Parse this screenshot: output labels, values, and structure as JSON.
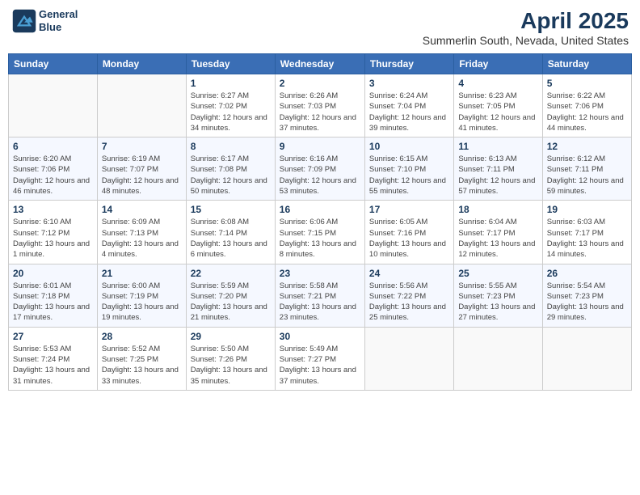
{
  "logo": {
    "line1": "General",
    "line2": "Blue"
  },
  "title": "April 2025",
  "subtitle": "Summerlin South, Nevada, United States",
  "weekdays": [
    "Sunday",
    "Monday",
    "Tuesday",
    "Wednesday",
    "Thursday",
    "Friday",
    "Saturday"
  ],
  "weeks": [
    [
      {
        "day": "",
        "empty": true
      },
      {
        "day": "",
        "empty": true
      },
      {
        "day": "1",
        "sunrise": "6:27 AM",
        "sunset": "7:02 PM",
        "daylight": "12 hours and 34 minutes."
      },
      {
        "day": "2",
        "sunrise": "6:26 AM",
        "sunset": "7:03 PM",
        "daylight": "12 hours and 37 minutes."
      },
      {
        "day": "3",
        "sunrise": "6:24 AM",
        "sunset": "7:04 PM",
        "daylight": "12 hours and 39 minutes."
      },
      {
        "day": "4",
        "sunrise": "6:23 AM",
        "sunset": "7:05 PM",
        "daylight": "12 hours and 41 minutes."
      },
      {
        "day": "5",
        "sunrise": "6:22 AM",
        "sunset": "7:06 PM",
        "daylight": "12 hours and 44 minutes."
      }
    ],
    [
      {
        "day": "6",
        "sunrise": "6:20 AM",
        "sunset": "7:06 PM",
        "daylight": "12 hours and 46 minutes."
      },
      {
        "day": "7",
        "sunrise": "6:19 AM",
        "sunset": "7:07 PM",
        "daylight": "12 hours and 48 minutes."
      },
      {
        "day": "8",
        "sunrise": "6:17 AM",
        "sunset": "7:08 PM",
        "daylight": "12 hours and 50 minutes."
      },
      {
        "day": "9",
        "sunrise": "6:16 AM",
        "sunset": "7:09 PM",
        "daylight": "12 hours and 53 minutes."
      },
      {
        "day": "10",
        "sunrise": "6:15 AM",
        "sunset": "7:10 PM",
        "daylight": "12 hours and 55 minutes."
      },
      {
        "day": "11",
        "sunrise": "6:13 AM",
        "sunset": "7:11 PM",
        "daylight": "12 hours and 57 minutes."
      },
      {
        "day": "12",
        "sunrise": "6:12 AM",
        "sunset": "7:11 PM",
        "daylight": "12 hours and 59 minutes."
      }
    ],
    [
      {
        "day": "13",
        "sunrise": "6:10 AM",
        "sunset": "7:12 PM",
        "daylight": "13 hours and 1 minute."
      },
      {
        "day": "14",
        "sunrise": "6:09 AM",
        "sunset": "7:13 PM",
        "daylight": "13 hours and 4 minutes."
      },
      {
        "day": "15",
        "sunrise": "6:08 AM",
        "sunset": "7:14 PM",
        "daylight": "13 hours and 6 minutes."
      },
      {
        "day": "16",
        "sunrise": "6:06 AM",
        "sunset": "7:15 PM",
        "daylight": "13 hours and 8 minutes."
      },
      {
        "day": "17",
        "sunrise": "6:05 AM",
        "sunset": "7:16 PM",
        "daylight": "13 hours and 10 minutes."
      },
      {
        "day": "18",
        "sunrise": "6:04 AM",
        "sunset": "7:17 PM",
        "daylight": "13 hours and 12 minutes."
      },
      {
        "day": "19",
        "sunrise": "6:03 AM",
        "sunset": "7:17 PM",
        "daylight": "13 hours and 14 minutes."
      }
    ],
    [
      {
        "day": "20",
        "sunrise": "6:01 AM",
        "sunset": "7:18 PM",
        "daylight": "13 hours and 17 minutes."
      },
      {
        "day": "21",
        "sunrise": "6:00 AM",
        "sunset": "7:19 PM",
        "daylight": "13 hours and 19 minutes."
      },
      {
        "day": "22",
        "sunrise": "5:59 AM",
        "sunset": "7:20 PM",
        "daylight": "13 hours and 21 minutes."
      },
      {
        "day": "23",
        "sunrise": "5:58 AM",
        "sunset": "7:21 PM",
        "daylight": "13 hours and 23 minutes."
      },
      {
        "day": "24",
        "sunrise": "5:56 AM",
        "sunset": "7:22 PM",
        "daylight": "13 hours and 25 minutes."
      },
      {
        "day": "25",
        "sunrise": "5:55 AM",
        "sunset": "7:23 PM",
        "daylight": "13 hours and 27 minutes."
      },
      {
        "day": "26",
        "sunrise": "5:54 AM",
        "sunset": "7:23 PM",
        "daylight": "13 hours and 29 minutes."
      }
    ],
    [
      {
        "day": "27",
        "sunrise": "5:53 AM",
        "sunset": "7:24 PM",
        "daylight": "13 hours and 31 minutes."
      },
      {
        "day": "28",
        "sunrise": "5:52 AM",
        "sunset": "7:25 PM",
        "daylight": "13 hours and 33 minutes."
      },
      {
        "day": "29",
        "sunrise": "5:50 AM",
        "sunset": "7:26 PM",
        "daylight": "13 hours and 35 minutes."
      },
      {
        "day": "30",
        "sunrise": "5:49 AM",
        "sunset": "7:27 PM",
        "daylight": "13 hours and 37 minutes."
      },
      {
        "day": "",
        "empty": true
      },
      {
        "day": "",
        "empty": true
      },
      {
        "day": "",
        "empty": true
      }
    ]
  ]
}
